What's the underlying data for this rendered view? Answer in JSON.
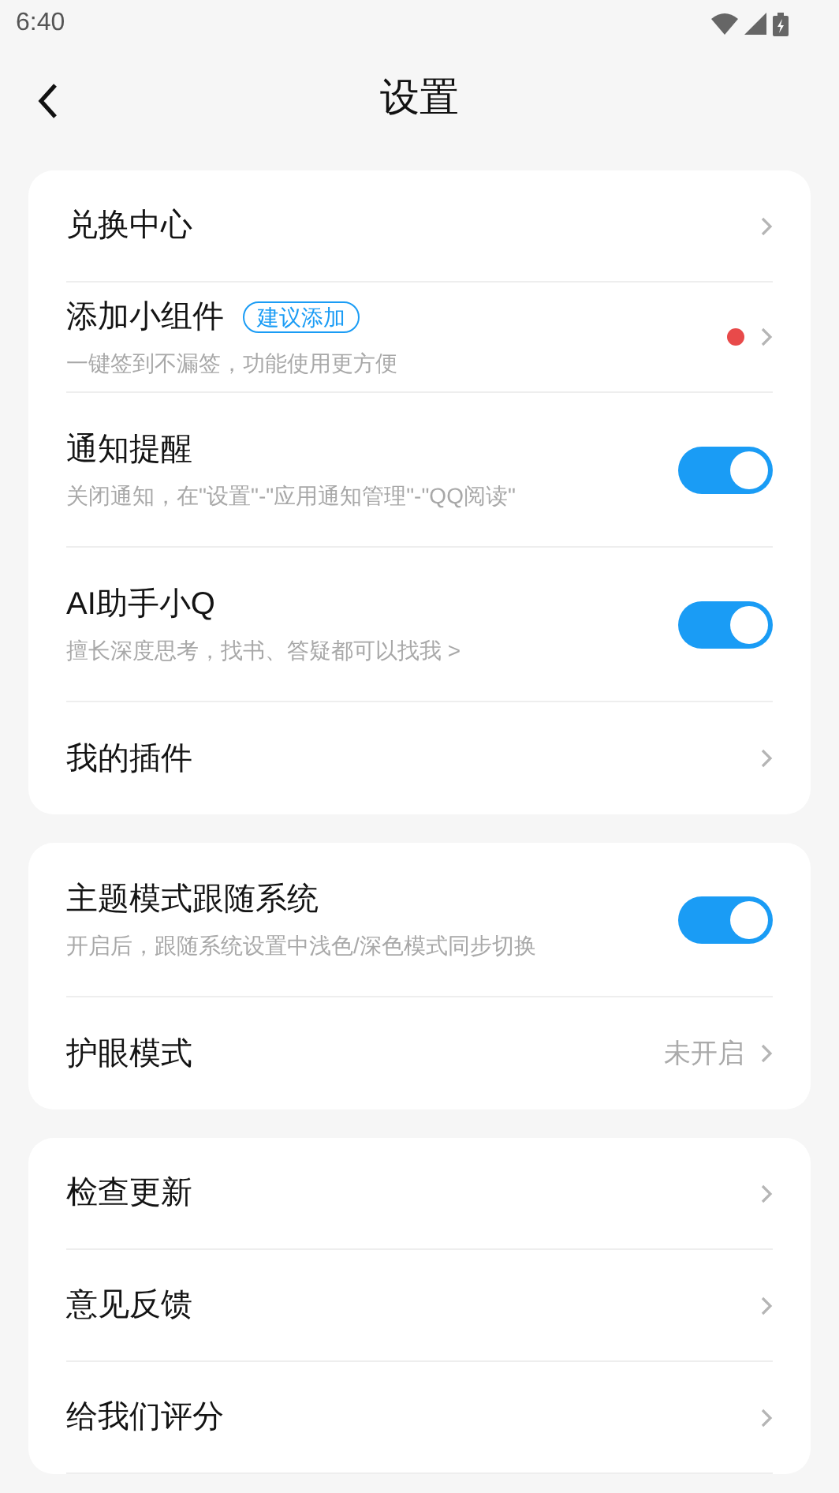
{
  "status_bar": {
    "time": "6:40"
  },
  "header": {
    "title": "设置"
  },
  "groups": [
    {
      "items": [
        {
          "kind": "link",
          "label": "兑换中心"
        },
        {
          "kind": "link",
          "label": "添加小组件",
          "badge": "建议添加",
          "subtitle": "一键签到不漏签，功能使用更方便",
          "dot": true
        },
        {
          "kind": "toggle",
          "label": "通知提醒",
          "subtitle": "关闭通知，在\"设置\"-\"应用通知管理\"-\"QQ阅读\"",
          "on": true
        },
        {
          "kind": "toggle",
          "label": "AI助手小Q",
          "subtitle": "擅长深度思考，找书、答疑都可以找我 >",
          "on": true
        },
        {
          "kind": "link",
          "label": "我的插件"
        }
      ]
    },
    {
      "items": [
        {
          "kind": "toggle",
          "label": "主题模式跟随系统",
          "subtitle": "开启后，跟随系统设置中浅色/深色模式同步切换",
          "on": true
        },
        {
          "kind": "link",
          "label": "护眼模式",
          "value": "未开启"
        }
      ]
    },
    {
      "items": [
        {
          "kind": "link",
          "label": "检查更新"
        },
        {
          "kind": "link",
          "label": "意见反馈"
        },
        {
          "kind": "link",
          "label": "给我们评分"
        }
      ]
    }
  ]
}
